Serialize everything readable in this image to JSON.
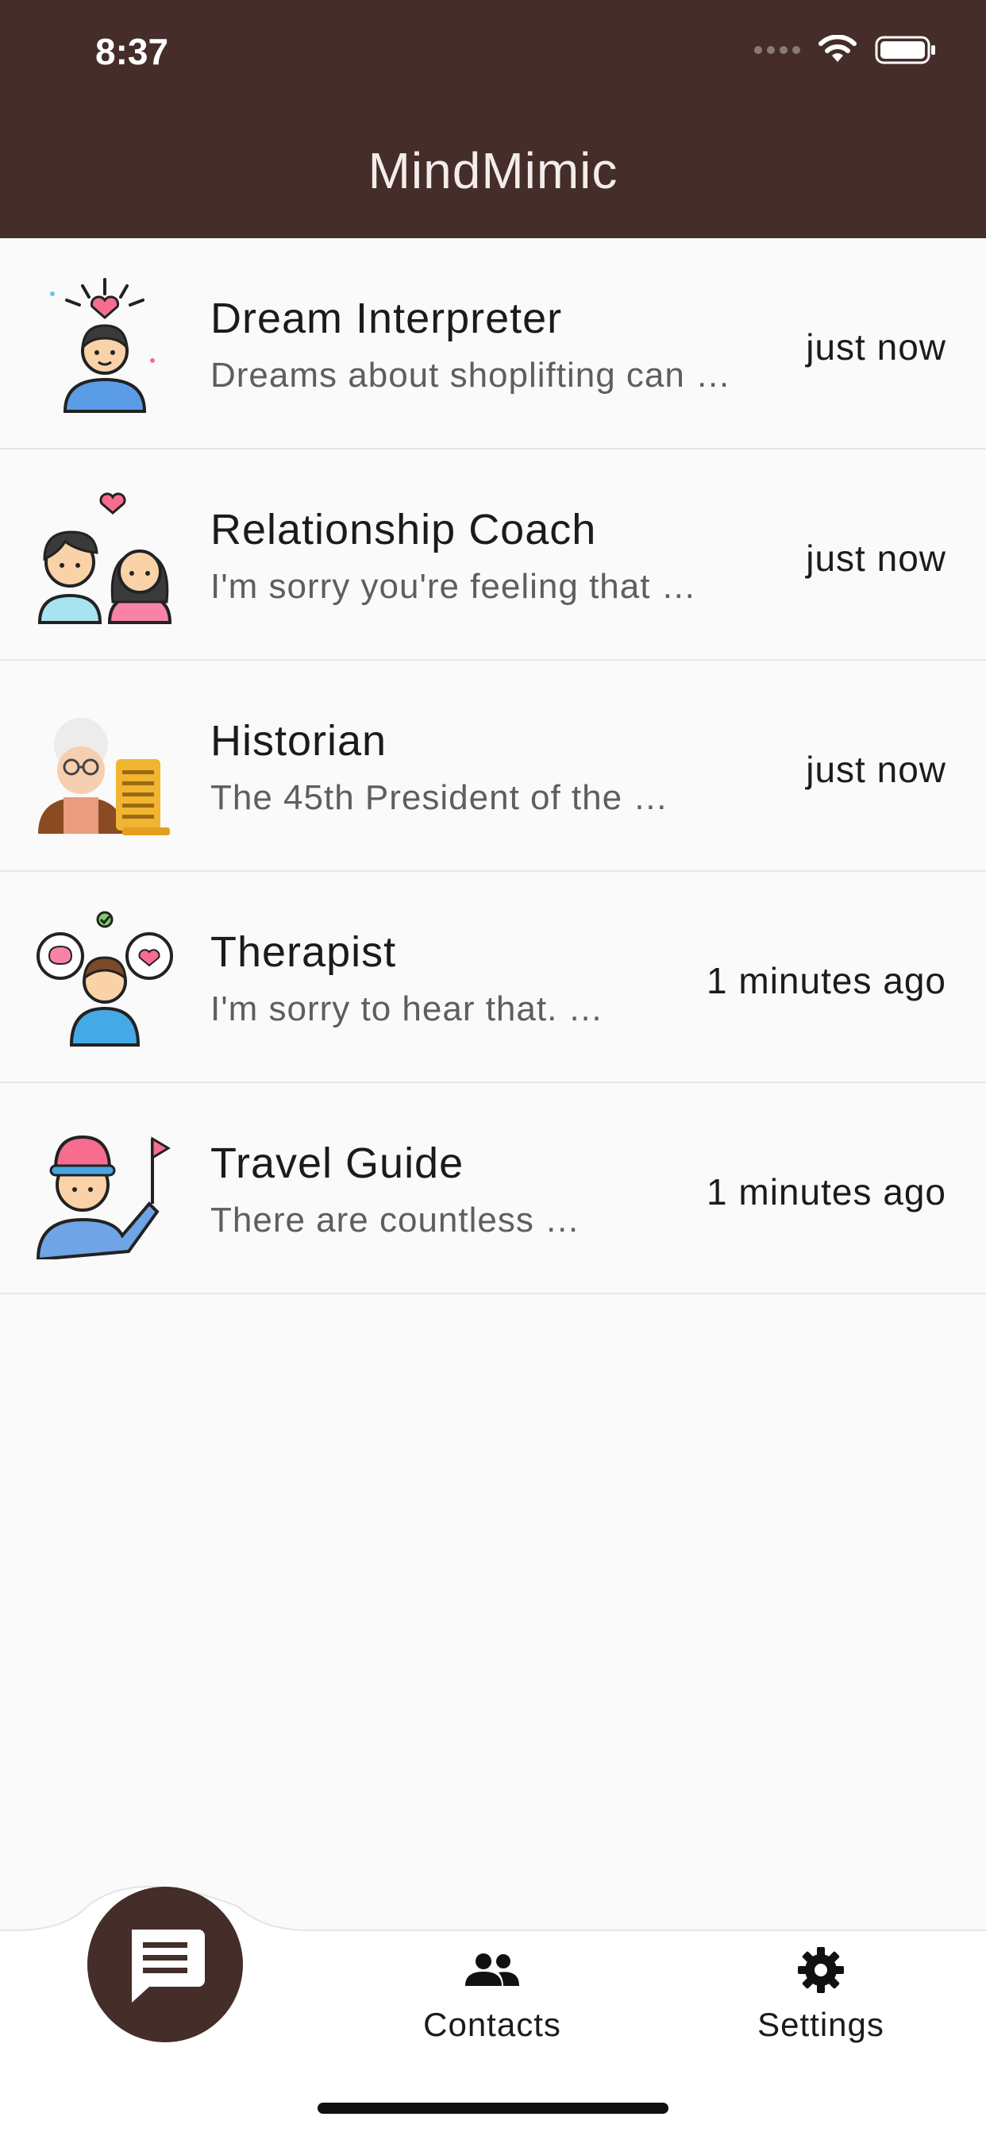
{
  "status_bar": {
    "time": "8:37"
  },
  "header": {
    "title": "MindMimic"
  },
  "conversations": [
    {
      "name": "Dream Interpreter",
      "preview": "Dreams about shoplifting can …",
      "time": "just now",
      "avatar_icon": "dream-interpreter-avatar-icon"
    },
    {
      "name": "Relationship Coach",
      "preview": "I'm sorry you're feeling that …",
      "time": "just now",
      "avatar_icon": "relationship-coach-avatar-icon"
    },
    {
      "name": "Historian",
      "preview": "The 45th President of the …",
      "time": "just now",
      "avatar_icon": "historian-avatar-icon"
    },
    {
      "name": "Therapist",
      "preview": "I'm sorry to hear that. …",
      "time": "1 minutes ago",
      "avatar_icon": "therapist-avatar-icon"
    },
    {
      "name": "Travel Guide",
      "preview": "There are countless …",
      "time": "1 minutes ago",
      "avatar_icon": "travel-guide-avatar-icon"
    }
  ],
  "bottom_nav": {
    "chats_icon": "chat-bubble-icon",
    "contacts_label": "Contacts",
    "settings_label": "Settings"
  },
  "colors": {
    "brand": "#452D2A",
    "background": "#FAFAFA"
  }
}
